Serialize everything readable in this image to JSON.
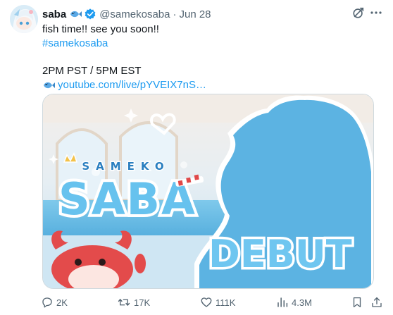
{
  "tweet": {
    "author": {
      "display_name": "saba",
      "handle": "@samekosaba",
      "verified": true
    },
    "separator": "·",
    "date": "Jun 28",
    "text_lines": [
      "fish time!! see you soon!!"
    ],
    "hashtag": "#samekosaba",
    "schedule": "2PM PST / 5PM EST",
    "link_text": "youtube.com/live/pYVEIX7nS…",
    "media": {
      "logo_small": "SAMEKO",
      "logo_big": "SABA",
      "banner_text": "DEBUT"
    },
    "stats": {
      "replies": "2K",
      "reposts": "17K",
      "likes": "111K",
      "views": "4.3M"
    }
  },
  "colors": {
    "link": "#1d9bf0",
    "secondary_text": "#536471",
    "primary_text": "#0f1419",
    "verified_badge": "#1d9bf0"
  },
  "icons": [
    "fish-icon",
    "verified-badge-icon",
    "grok-icon",
    "more-icon",
    "reply-icon",
    "repost-icon",
    "like-icon",
    "views-icon",
    "bookmark-icon",
    "share-icon"
  ]
}
